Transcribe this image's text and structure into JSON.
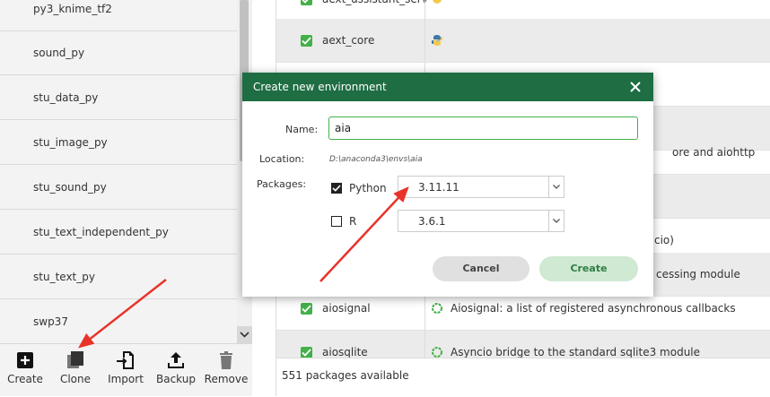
{
  "env_list": {
    "items": [
      {
        "label": "py3_knime_tf2"
      },
      {
        "label": "sound_py"
      },
      {
        "label": "stu_data_py"
      },
      {
        "label": "stu_image_py"
      },
      {
        "label": "stu_sound_py"
      },
      {
        "label": "stu_text_independent_py"
      },
      {
        "label": "stu_text_py"
      },
      {
        "label": "swp37"
      }
    ]
  },
  "toolbar": {
    "create_label": "Create",
    "clone_label": "Clone",
    "import_label": "Import",
    "backup_label": "Backup",
    "remove_label": "Remove"
  },
  "packages": {
    "rows": [
      {
        "name": "aext_assistant_serv",
        "desc": ""
      },
      {
        "name": "aext_core",
        "desc": ""
      },
      {
        "name": "",
        "desc": ""
      },
      {
        "name": "",
        "desc": ""
      },
      {
        "name": "",
        "desc": "ore and aiohttp"
      },
      {
        "name": "",
        "desc": ""
      },
      {
        "name": "",
        "desc": "cio)"
      },
      {
        "name": "",
        "desc": "cessing module"
      },
      {
        "name": "aiosignal",
        "desc": "Aiosignal: a list of registered asynchronous callbacks"
      },
      {
        "name": "aiosqlite",
        "desc": "Asyncio bridge to the standard sqlite3 module"
      }
    ],
    "footer": "551 packages available"
  },
  "modal": {
    "title": "Create new environment",
    "name_label": "Name:",
    "name_value": "aia",
    "location_label": "Location:",
    "location_value": "D:\\anaconda3\\envs\\aia",
    "packages_label": "Packages:",
    "python_label": "Python",
    "python_checked": true,
    "python_version": "3.11.11",
    "r_label": "R",
    "r_checked": false,
    "r_version": "3.6.1",
    "cancel_label": "Cancel",
    "create_label": "Create"
  },
  "colors": {
    "header_green": "#1e6d43",
    "check_green": "#43b049",
    "annotation_red": "#e8332a"
  }
}
